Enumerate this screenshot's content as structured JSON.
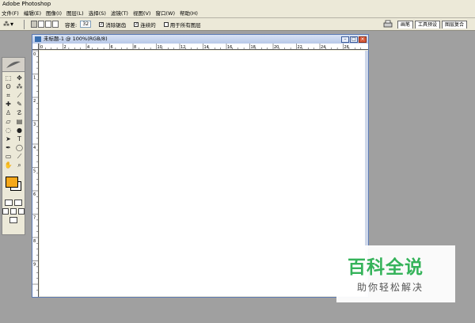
{
  "window": {
    "title": "Adobe Photoshop"
  },
  "menu": [
    "文件(F)",
    "编辑(E)",
    "图像(I)",
    "图层(L)",
    "选择(S)",
    "滤镜(T)",
    "视图(V)",
    "窗口(W)",
    "帮助(H)"
  ],
  "options_bar": {
    "tolerance_label": "容差:",
    "tolerance_value": "32",
    "antialias_label": "消除锯齿",
    "contiguous_label": "连续的",
    "all_layers_label": "用于所有图层",
    "tabs": [
      "画笔",
      "工具预设",
      "图层复合"
    ]
  },
  "document": {
    "title": "未标题-1 @ 100%(RGB/8)"
  },
  "rulers": {
    "horizontal": [
      "0",
      "2",
      "4",
      "6",
      "8",
      "10",
      "12",
      "14",
      "16",
      "18",
      "20",
      "22",
      "24",
      "26"
    ],
    "vertical": [
      "0",
      "1",
      "2",
      "3",
      "4",
      "5",
      "6",
      "7",
      "8",
      "9"
    ]
  },
  "colors": {
    "foreground": "#f5a81a",
    "background": "#ffffff",
    "workspace": "#a0a0a0"
  },
  "watermark": {
    "title": "百科全说",
    "subtitle": "助你轻松解决"
  }
}
